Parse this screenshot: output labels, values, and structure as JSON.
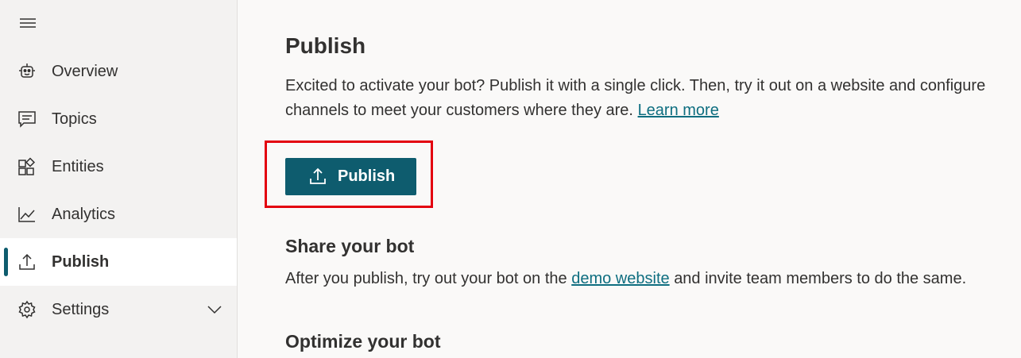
{
  "sidebar": {
    "items": [
      {
        "label": "Overview",
        "icon": "bot-icon"
      },
      {
        "label": "Topics",
        "icon": "chat-icon"
      },
      {
        "label": "Entities",
        "icon": "shapes-icon"
      },
      {
        "label": "Analytics",
        "icon": "line-chart-icon"
      },
      {
        "label": "Publish",
        "icon": "upload-icon",
        "selected": true
      },
      {
        "label": "Settings",
        "icon": "gear-icon",
        "expandable": true
      }
    ]
  },
  "main": {
    "title": "Publish",
    "description": "Excited to activate your bot? Publish it with a single click. Then, try it out on a website and configure channels to meet your customers where they are.",
    "learn_more": "Learn more",
    "publish_button": "Publish",
    "share": {
      "title": "Share your bot",
      "text_before": "After you publish, try out your bot on the",
      "link": "demo website",
      "text_after": "and invite team members to do the same."
    },
    "optimize": {
      "title": "Optimize your bot"
    }
  },
  "colors": {
    "accent": "#0e5c6e",
    "link": "#0e6e80",
    "highlight": "#e3000f",
    "sidebar_bg": "#f3f2f1",
    "main_bg": "#faf9f8"
  }
}
